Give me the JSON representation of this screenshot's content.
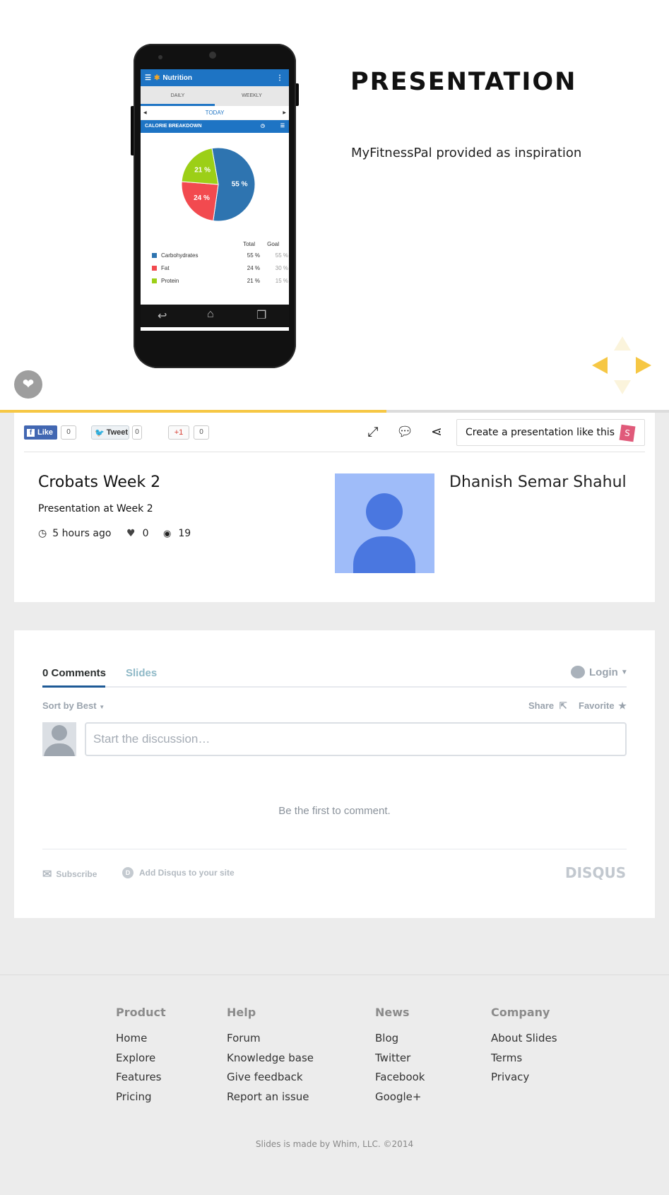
{
  "slide": {
    "title": "PRESENTATION",
    "text": "MyFitnessPal provided as inspiration",
    "progress_fraction": 0.578,
    "phone_app": {
      "app_title": "Nutrition",
      "tabs": [
        "DAILY",
        "WEEKLY"
      ],
      "date_label": "TODAY",
      "section_label": "CALORIE BREAKDOWN",
      "col_total": "Total",
      "col_goal": "Goal",
      "breakdown": [
        {
          "name": "Carbohydrates",
          "total": "55 %",
          "goal": "55 %",
          "percent": 55,
          "label": "55 %",
          "color": "#2e74b0"
        },
        {
          "name": "Fat",
          "total": "24 %",
          "goal": "30 %",
          "percent": 24,
          "label": "24 %",
          "color": "#f24a4f"
        },
        {
          "name": "Protein",
          "total": "21 %",
          "goal": "15 %",
          "percent": 21,
          "label": "21 %",
          "color": "#9ccf17"
        }
      ]
    }
  },
  "social": {
    "like_label": "Like",
    "like_count": "0",
    "tweet_label": "Tweet",
    "tweet_count": "0",
    "gplus_label": "+1",
    "gplus_count": "0"
  },
  "toolbar": {
    "create_label": "Create a presentation like this",
    "create_badge": "S"
  },
  "deck": {
    "title": "Crobats Week 2",
    "description": "Presentation at Week 2",
    "time_ago": "5 hours ago",
    "likes": "0",
    "views": "19",
    "author": "Dhanish Semar Shahul"
  },
  "disqus": {
    "comments_tab": "0 Comments",
    "site_tab": "Slides",
    "login_label": "Login",
    "sort_label": "Sort by Best",
    "share_label": "Share",
    "favorite_label": "Favorite",
    "input_placeholder": "Start the discussion…",
    "empty_text": "Be the first to comment.",
    "subscribe_label": "Subscribe",
    "add_disqus_label": "Add Disqus to your site",
    "brand": "DISQUS"
  },
  "footer": {
    "columns": [
      {
        "heading": "Product",
        "links": [
          "Home",
          "Explore",
          "Features",
          "Pricing"
        ]
      },
      {
        "heading": "Help",
        "links": [
          "Forum",
          "Knowledge base",
          "Give feedback",
          "Report an issue"
        ]
      },
      {
        "heading": "News",
        "links": [
          "Blog",
          "Twitter",
          "Facebook",
          "Google+"
        ]
      },
      {
        "heading": "Company",
        "links": [
          "About Slides",
          "Terms",
          "Privacy"
        ]
      }
    ],
    "copyright": "Slides is made by Whim, LLC. ©2014"
  },
  "colors": {
    "accent_yellow": "#f6c744",
    "android_blue": "#1e74c4",
    "avatar_blue": "#9fbcf9",
    "avatar_fg": "#4a77e0"
  }
}
